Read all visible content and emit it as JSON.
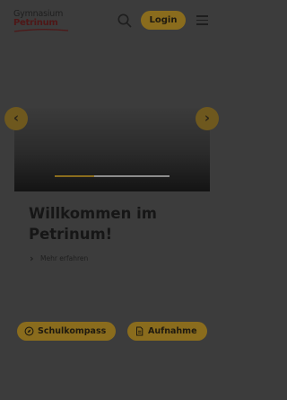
{
  "header": {
    "logo_line1": "Gymnasium",
    "logo_line2": "Petrinum",
    "login_label": "Login"
  },
  "hero": {
    "slide_progress": 0.34,
    "prev_arrow": "‹",
    "next_arrow": "›",
    "headline": "Willkommen im Petrinum!",
    "more_label": "Mehr erfahren"
  },
  "quicklinks": [
    {
      "label": "Schulkompass",
      "icon": "compass-icon"
    },
    {
      "label": "Aufnahme",
      "icon": "document-icon"
    }
  ],
  "colors": {
    "accent": "#8a6c1d",
    "overlay_background": "#3c3c3c",
    "brand_dark_red": "#4e1717"
  }
}
